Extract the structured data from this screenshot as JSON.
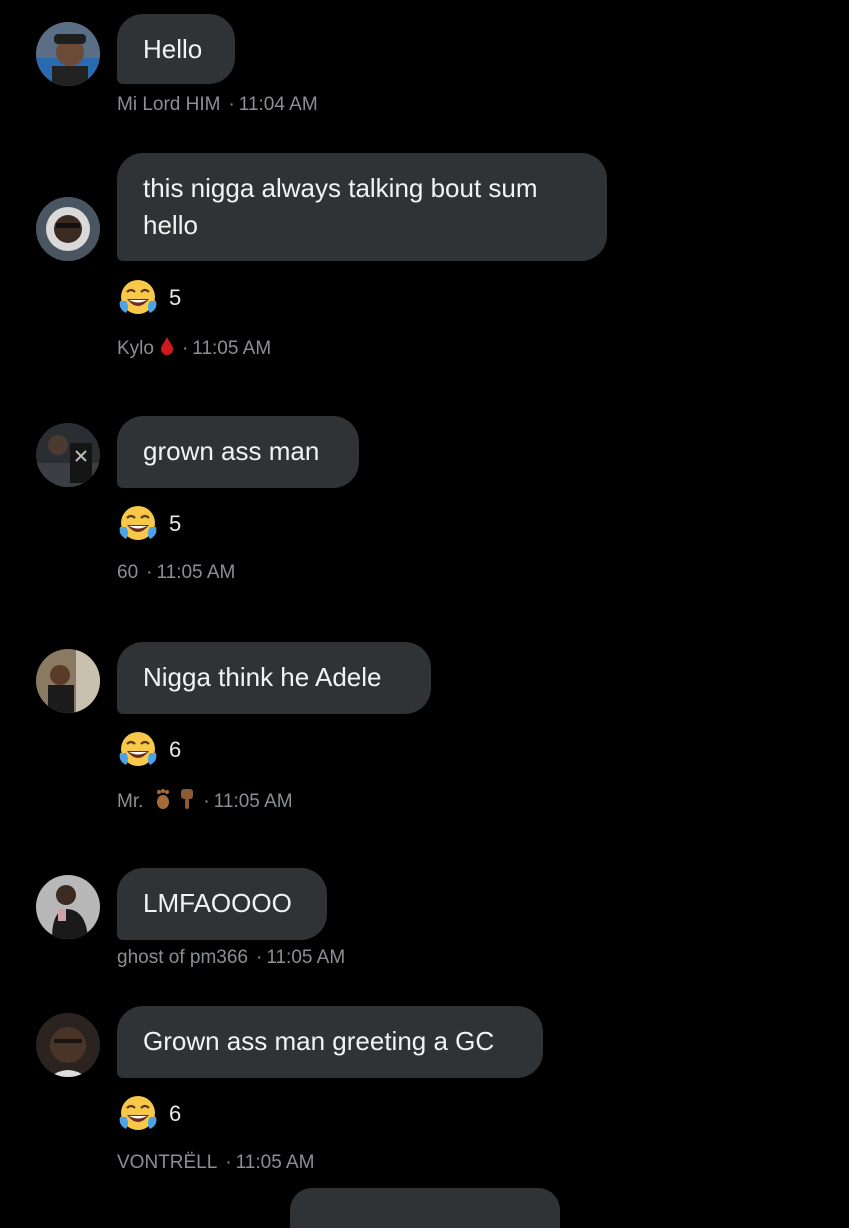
{
  "messages": [
    {
      "avatar": "avatar-photo",
      "text": "Hello",
      "reaction": null,
      "author": "Mi Lord HIM",
      "time": "11:04 AM",
      "author_icons": []
    },
    {
      "avatar": "avatar-photo",
      "text": "this nigga always talking bout sum\nhello",
      "reaction": {
        "emoji": "face-with-tears-of-joy-icon",
        "count": "5"
      },
      "author": "Kylo",
      "time": "11:05 AM",
      "author_icons": [
        "drop-of-blood-icon"
      ]
    },
    {
      "avatar": "avatar-photo",
      "text": "grown ass man",
      "reaction": {
        "emoji": "face-with-tears-of-joy-icon",
        "count": "5"
      },
      "author": "60",
      "time": "11:05 AM",
      "author_icons": []
    },
    {
      "avatar": "avatar-photo",
      "text": "Nigga think he Adele",
      "reaction": {
        "emoji": "face-with-tears-of-joy-icon",
        "count": "6"
      },
      "author": "Mr.",
      "time": "11:05 AM",
      "author_icons": [
        "foot-icon",
        "pointing-down-icon"
      ]
    },
    {
      "avatar": "avatar-photo",
      "text": "LMFAOOOO",
      "reaction": null,
      "author": "ghost of pm366",
      "time": "11:05 AM",
      "author_icons": []
    },
    {
      "avatar": "avatar-photo",
      "text": "Grown ass man greeting a GC",
      "reaction": {
        "emoji": "face-with-tears-of-joy-icon",
        "count": "6"
      },
      "author": "VONTRËLL",
      "time": "11:05 AM",
      "author_icons": []
    }
  ],
  "separator": "·",
  "colors": {
    "background": "#000000",
    "bubble": "#2f3336",
    "meta_text": "#8b8f93"
  }
}
